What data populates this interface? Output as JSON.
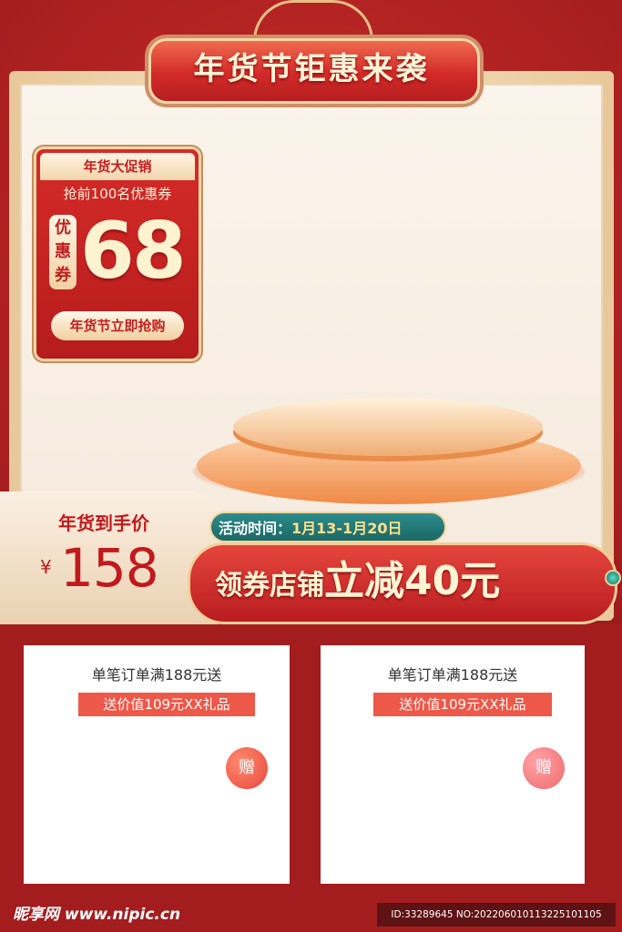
{
  "title": "年货节钜惠来袭",
  "coupon": {
    "header": "年货大促销",
    "subtitle": "抢前100名优惠券",
    "label": "优惠券",
    "amount": "68",
    "button": "年货节立即抢购"
  },
  "price": {
    "label": "年货到手价",
    "currency": "¥",
    "value": "158"
  },
  "activity": {
    "label": "活动时间：",
    "dates": "1月13-1月20日"
  },
  "promo": {
    "prefix": "领券店铺",
    "highlight": "立减40元"
  },
  "cards": [
    {
      "title": "单笔订单满188元送",
      "tag": "送价值109元XX礼品",
      "gift": "赠",
      "gift_color": "#e8473a"
    },
    {
      "title": "单笔订单满188元送",
      "tag": "送价值109元XX礼品",
      "gift": "赠",
      "gift_color": "#ee6a6e"
    }
  ],
  "watermark": {
    "brand": "昵享网 www.nipic.cn",
    "id": "ID:33289645 NO:20220601011322510110​5"
  },
  "colors": {
    "primary_red": "#b81d20",
    "gold": "#f2cf99",
    "teal": "#1b6866"
  }
}
